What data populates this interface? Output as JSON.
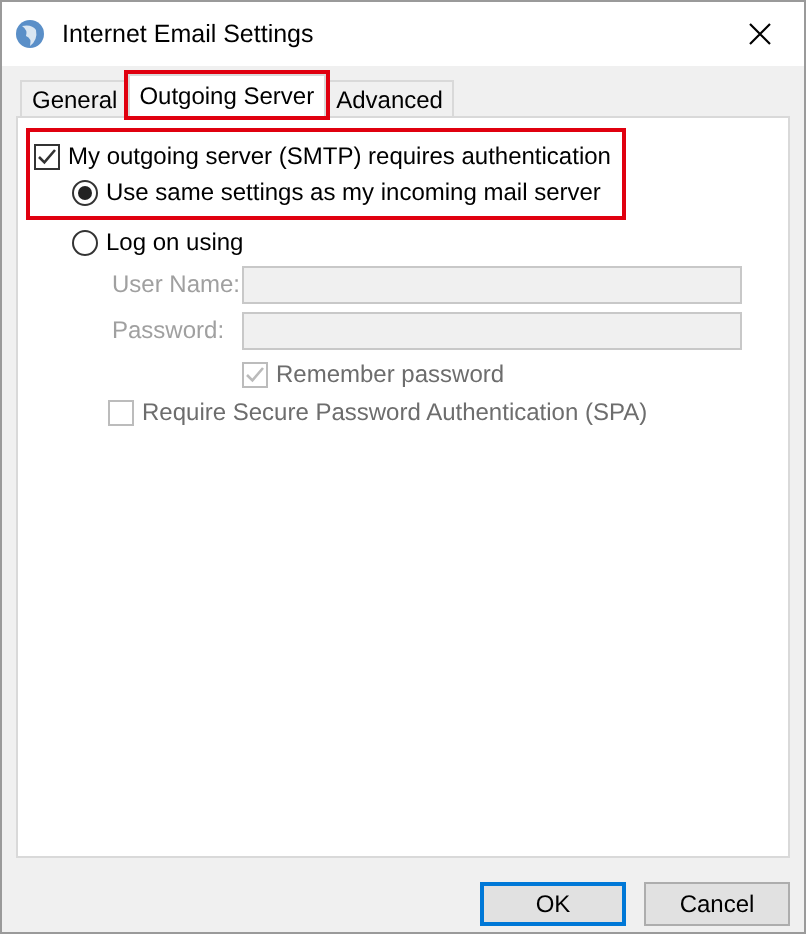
{
  "window": {
    "title": "Internet Email Settings"
  },
  "tabs": [
    {
      "label": "General",
      "selected": false,
      "highlighted": false
    },
    {
      "label": "Outgoing Server",
      "selected": true,
      "highlighted": true
    },
    {
      "label": "Advanced",
      "selected": false,
      "highlighted": false
    }
  ],
  "auth": {
    "label": "My outgoing server (SMTP) requires authentication",
    "checked": true,
    "highlighted": true
  },
  "options": [
    {
      "label": "Use same settings as my incoming mail server",
      "selected": true
    },
    {
      "label": "Log on using",
      "selected": false
    }
  ],
  "fields": [
    {
      "label": "User Name:",
      "disabled": true
    },
    {
      "label": "Password:",
      "disabled": true
    }
  ],
  "remember": {
    "label": "Remember password",
    "checked": true,
    "disabled": true
  },
  "spa": {
    "label": "Require Secure Password Authentication (SPA)",
    "checked": false,
    "disabled": true
  },
  "buttons": [
    {
      "label": "OK",
      "default": true
    },
    {
      "label": "Cancel",
      "default": false
    }
  ]
}
